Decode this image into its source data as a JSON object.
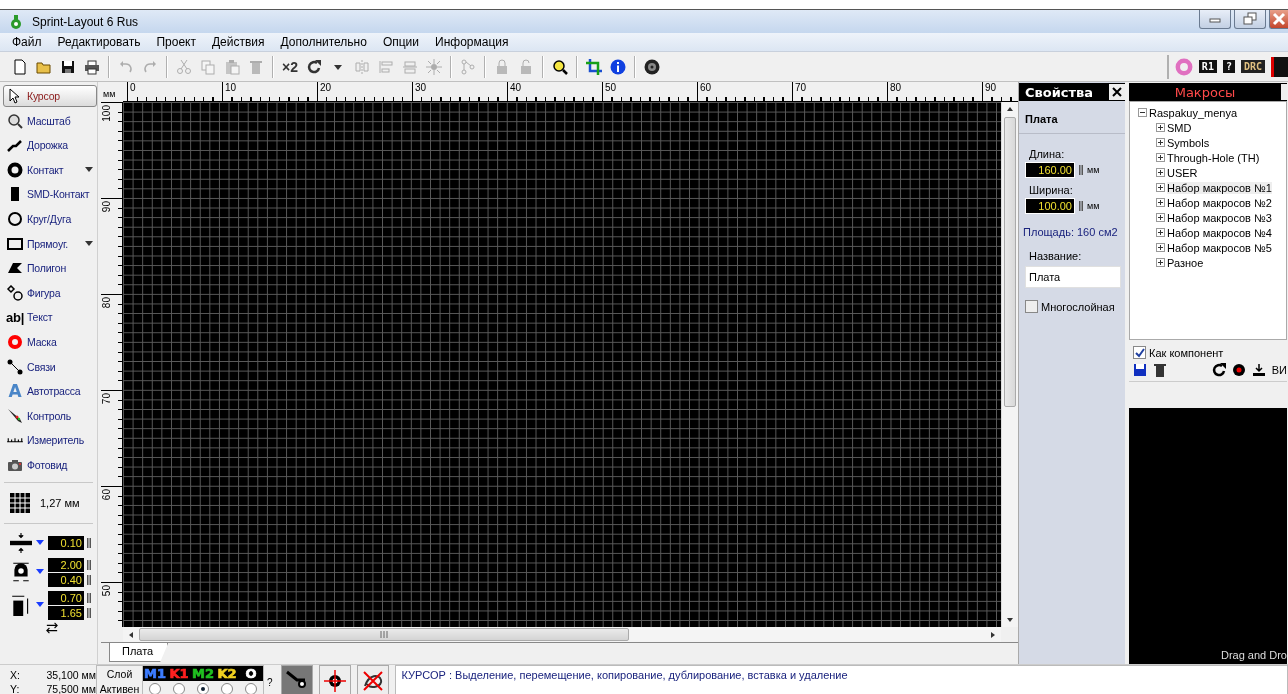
{
  "window": {
    "title": "Sprint-Layout 6 Rus"
  },
  "menu": [
    "Файл",
    "Редактировать",
    "Проект",
    "Действия",
    "Дополнительно",
    "Опции",
    "Информация"
  ],
  "toolbar": [
    {
      "kind": "new",
      "disabled": false
    },
    {
      "kind": "open",
      "disabled": false
    },
    {
      "kind": "save",
      "disabled": false
    },
    {
      "kind": "print",
      "disabled": false
    },
    {
      "kind": "separator"
    },
    {
      "kind": "undo",
      "disabled": true
    },
    {
      "kind": "redo",
      "disabled": true
    },
    {
      "kind": "separator"
    },
    {
      "kind": "cut",
      "disabled": true
    },
    {
      "kind": "copy",
      "disabled": true
    },
    {
      "kind": "paste",
      "disabled": true
    },
    {
      "kind": "delete",
      "disabled": true
    },
    {
      "kind": "separator"
    },
    {
      "kind": "text",
      "label": "×2",
      "disabled": false
    },
    {
      "kind": "rotate",
      "disabled": false
    },
    {
      "kind": "caret",
      "disabled": false
    },
    {
      "kind": "mirror",
      "disabled": true
    },
    {
      "kind": "align",
      "disabled": true
    },
    {
      "kind": "flip",
      "disabled": true
    },
    {
      "kind": "snap",
      "disabled": true
    },
    {
      "kind": "separator"
    },
    {
      "kind": "group",
      "disabled": true
    },
    {
      "kind": "separator"
    },
    {
      "kind": "lock",
      "disabled": true
    },
    {
      "kind": "unlock",
      "disabled": true
    },
    {
      "kind": "separator"
    },
    {
      "kind": "zoom",
      "disabled": false
    },
    {
      "kind": "separator"
    },
    {
      "kind": "crop",
      "disabled": false
    },
    {
      "kind": "info",
      "disabled": false
    },
    {
      "kind": "separator"
    },
    {
      "kind": "gear",
      "disabled": false
    }
  ],
  "toolbar_right": [
    {
      "kind": "ring"
    },
    {
      "kind": "tag",
      "label": "R1"
    },
    {
      "kind": "help",
      "label": "?"
    },
    {
      "kind": "drc",
      "label": "DRC"
    }
  ],
  "tools": [
    {
      "kind": "cursor",
      "label": "Курсор",
      "selected": true,
      "has_menu": false
    },
    {
      "kind": "zoom",
      "label": "Масштаб",
      "selected": false,
      "has_menu": false
    },
    {
      "kind": "track",
      "label": "Дорожка",
      "selected": false,
      "has_menu": false
    },
    {
      "kind": "pad",
      "label": "Контакт",
      "selected": false,
      "has_menu": true
    },
    {
      "kind": "smd",
      "label": "SMD-Контакт",
      "selected": false,
      "has_menu": false
    },
    {
      "kind": "circle",
      "label": "Круг/Дуга",
      "selected": false,
      "has_menu": false
    },
    {
      "kind": "rect",
      "label": "Прямоуг.",
      "selected": false,
      "has_menu": true
    },
    {
      "kind": "polygon",
      "label": "Полигон",
      "selected": false,
      "has_menu": false
    },
    {
      "kind": "shape",
      "label": "Фигура",
      "selected": false,
      "has_menu": false
    },
    {
      "kind": "text",
      "glyph": "ab|",
      "label": "Текст",
      "selected": false,
      "has_menu": false
    },
    {
      "kind": "mask",
      "label": "Маска",
      "selected": false,
      "has_menu": false
    },
    {
      "kind": "links",
      "label": "Связи",
      "selected": false,
      "has_menu": false
    },
    {
      "kind": "autoroute",
      "glyph": "A",
      "label": "Автотрасса",
      "selected": false,
      "has_menu": false
    },
    {
      "kind": "probe",
      "label": "Контроль",
      "selected": false,
      "has_menu": false
    },
    {
      "kind": "measure",
      "label": "Измеритель",
      "selected": false,
      "has_menu": false
    },
    {
      "kind": "photo",
      "label": "Фотовид",
      "selected": false,
      "has_menu": false
    }
  ],
  "grid": {
    "label": "1,27 мм"
  },
  "sizes": [
    {
      "kind": "track",
      "values": [
        "0.10"
      ]
    },
    {
      "kind": "pad",
      "values": [
        "2.00",
        "0.40"
      ]
    },
    {
      "kind": "smd",
      "values": [
        "0.70",
        "1.65"
      ]
    }
  ],
  "ruler": {
    "unit": "мм",
    "x_labels": [
      "0",
      "10",
      "20",
      "30",
      "40",
      "50",
      "60",
      "70",
      "80",
      "90"
    ],
    "y_labels": [
      "100",
      "90",
      "80",
      "70",
      "60",
      "50"
    ]
  },
  "sheet_tabs": [
    {
      "label": "Плата",
      "selected": true
    }
  ],
  "properties": {
    "title": "Свойства",
    "section": "Плата",
    "fields": [
      {
        "label": "Длина:",
        "value": "160.00",
        "unit": "мм"
      },
      {
        "label": "Ширина:",
        "value": "100.00",
        "unit": "мм"
      }
    ],
    "area": "Площадь: 160 см2",
    "name_label": "Название:",
    "name_value": "Плата",
    "multilayer": {
      "label": "Многослойная",
      "checked": false
    }
  },
  "macros": {
    "title": "Макросы",
    "tree": [
      {
        "label": "Raspakuy_menya",
        "expanded": true,
        "selected": false,
        "children": [
          {
            "label": "SMD",
            "expanded": false,
            "selected": false
          },
          {
            "label": "Symbols",
            "expanded": false,
            "selected": false
          },
          {
            "label": "Through-Hole (TH)",
            "expanded": false,
            "selected": false
          },
          {
            "label": "USER",
            "expanded": false,
            "selected": false
          },
          {
            "label": "Набор макросов №1",
            "expanded": false,
            "selected": true
          },
          {
            "label": "Набор макросов №2",
            "expanded": false,
            "selected": false
          },
          {
            "label": "Набор макросов №3",
            "expanded": false,
            "selected": false
          },
          {
            "label": "Набор макросов №4",
            "expanded": false,
            "selected": false
          },
          {
            "label": "Набор макросов №5",
            "expanded": false,
            "selected": false
          },
          {
            "label": "Разное",
            "expanded": false,
            "selected": false
          }
        ]
      }
    ],
    "as_component": {
      "label": "Как компонент",
      "checked": true
    },
    "view_label": "ВИ",
    "preview_hint": "Drag and Dro"
  },
  "status": {
    "x_label": "X:",
    "x_value": "35,100 мм",
    "y_label": "Y:",
    "y_value": "75,500 мм",
    "layer_label": "Слой",
    "active_label": "Активен",
    "layers": [
      {
        "label": "M1",
        "color": "#3c7cff",
        "selected": false
      },
      {
        "label": "K1",
        "color": "#ff2020",
        "selected": false
      },
      {
        "label": "M2",
        "color": "#20c020",
        "selected": true
      },
      {
        "label": "K2",
        "color": "#f0d020",
        "selected": false
      },
      {
        "label": "O",
        "color": "#ffffff",
        "selected": false
      }
    ],
    "help": "?",
    "message": "КУРСОР : Выделение, перемещение, копирование, дублирование, вставка и удаление"
  }
}
